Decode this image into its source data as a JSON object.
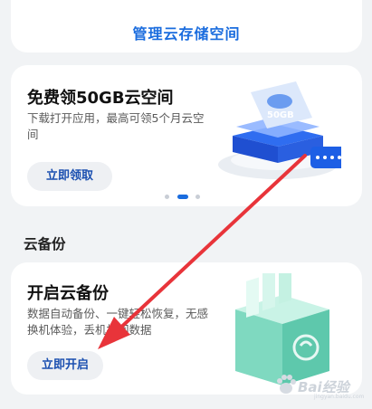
{
  "manage": {
    "link_label": "管理云存储空间"
  },
  "promo": {
    "title": "免费领50GB云空间",
    "description": "下载打开应用，最高可领5个月云空间",
    "button_label": "立即领取",
    "art_badge": "50GB",
    "pager": {
      "count": 3,
      "active_index": 1
    }
  },
  "section": {
    "title": "云备份"
  },
  "backup": {
    "title": "开启云备份",
    "description": "数据自动备份、一键轻松恢复，无感换机体验，丢机找回数据",
    "button_label": "立即开启"
  },
  "annotation": {
    "arrow_color": "#e8343a"
  },
  "watermark": {
    "text": "Bai经验",
    "sub": "jingyan.baidu.com"
  },
  "colors": {
    "accent": "#1a6cde",
    "background": "#f1f3f5",
    "card": "#ffffff"
  }
}
